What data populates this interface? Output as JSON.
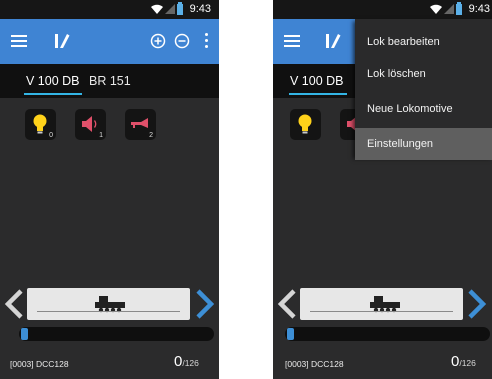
{
  "status_bar": {
    "time": "9:43"
  },
  "left_screen": {
    "tabs": [
      {
        "label": "V 100 DB",
        "active": true
      },
      {
        "label": "BR 151",
        "active": false
      }
    ],
    "functions": [
      {
        "icon": "light-bulb-icon",
        "index": "0"
      },
      {
        "icon": "speaker-icon",
        "index": "1"
      },
      {
        "icon": "horn-icon",
        "index": "2"
      }
    ],
    "address": "[0003]  DCC128",
    "speed": {
      "value": "0",
      "max": "/126"
    },
    "speed_level": 0
  },
  "right_screen": {
    "tabs": [
      {
        "label": "V 100 DB",
        "active": true
      }
    ],
    "menu": {
      "items": [
        {
          "label": "Lok bearbeiten",
          "highlighted": false
        },
        {
          "label": "Lok löschen",
          "highlighted": false
        },
        {
          "label": "Neue Lokomotive",
          "highlighted": false
        },
        {
          "label": "Einstellungen",
          "highlighted": true
        }
      ]
    },
    "address": "[0003]  DCC128",
    "speed": {
      "value": "0",
      "max": "/126"
    }
  },
  "colors": {
    "appbar": "#3f84d3",
    "accent": "#33b5e5",
    "background": "#2b2b2c",
    "light_bulb": "#ffd21a",
    "speaker": "#e0506a",
    "horn": "#e0506a"
  }
}
